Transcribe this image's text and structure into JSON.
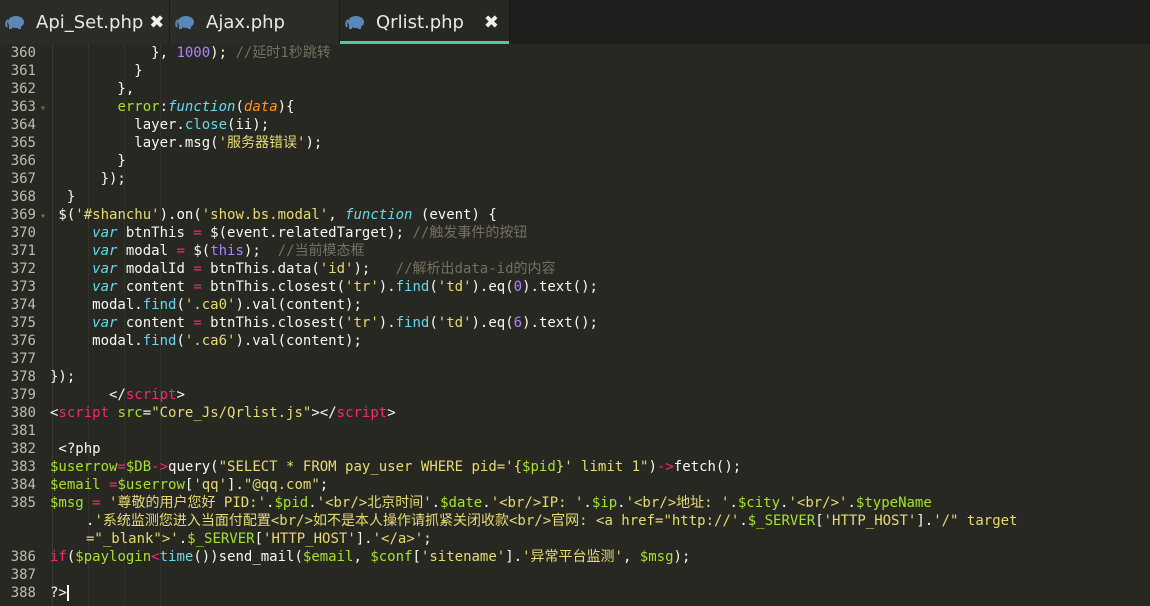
{
  "tabs": [
    {
      "label": "Api_Set.php",
      "close": "✖",
      "active": false
    },
    {
      "label": "Ajax.php",
      "close": "",
      "active": false
    },
    {
      "label": "Qrlist.php",
      "close": "✖",
      "active": true
    }
  ],
  "colors": {
    "background": "#272822",
    "tab_active_underline": "#50c8a0",
    "string": "#e6db74",
    "keyword": "#f92672",
    "function": "#66d9ef",
    "variable": "#a6e22e",
    "number": "#ae81ff",
    "comment": "#75715e"
  },
  "icons": {
    "tab": "php-elephant-icon",
    "fold": "fold-arrow-icon"
  },
  "lines": [
    {
      "n": "360",
      "fold": "",
      "segs": [
        [
          "p",
          "            }, "
        ],
        [
          "n",
          "1000"
        ],
        [
          "p",
          "); "
        ],
        [
          "c",
          "//延时1秒跳转"
        ]
      ]
    },
    {
      "n": "361",
      "fold": "",
      "segs": [
        [
          "p",
          "          }"
        ]
      ]
    },
    {
      "n": "362",
      "fold": "",
      "segs": [
        [
          "p",
          "        },"
        ]
      ]
    },
    {
      "n": "363",
      "fold": "▾",
      "segs": [
        [
          "p",
          "        "
        ],
        [
          "v",
          "error"
        ],
        [
          "p",
          ":"
        ],
        [
          "i",
          "function"
        ],
        [
          "p",
          "("
        ],
        [
          "a",
          "data"
        ],
        [
          "p",
          "){"
        ]
      ]
    },
    {
      "n": "364",
      "fold": "",
      "segs": [
        [
          "p",
          "          layer."
        ],
        [
          "f",
          "close"
        ],
        [
          "p",
          "(ii);"
        ]
      ]
    },
    {
      "n": "365",
      "fold": "",
      "segs": [
        [
          "p",
          "          layer.msg("
        ],
        [
          "s",
          "'服务器错误'"
        ],
        [
          "p",
          ");"
        ]
      ]
    },
    {
      "n": "366",
      "fold": "",
      "segs": [
        [
          "p",
          "        }"
        ]
      ]
    },
    {
      "n": "367",
      "fold": "",
      "segs": [
        [
          "p",
          "      });"
        ]
      ]
    },
    {
      "n": "368",
      "fold": "",
      "segs": [
        [
          "p",
          "  }"
        ]
      ]
    },
    {
      "n": "369",
      "fold": "▾",
      "segs": [
        [
          "p",
          " $("
        ],
        [
          "s",
          "'#shanchu'"
        ],
        [
          "p",
          ").on("
        ],
        [
          "s",
          "'show.bs.modal'"
        ],
        [
          "p",
          ", "
        ],
        [
          "i",
          "function"
        ],
        [
          "p",
          " (event) {"
        ]
      ]
    },
    {
      "n": "370",
      "fold": "",
      "segs": [
        [
          "p",
          "     "
        ],
        [
          "i",
          "var"
        ],
        [
          "p",
          " btnThis "
        ],
        [
          "k",
          "="
        ],
        [
          "p",
          " $(event.relatedTarget); "
        ],
        [
          "c",
          "//触发事件的按钮"
        ]
      ]
    },
    {
      "n": "371",
      "fold": "",
      "segs": [
        [
          "p",
          "     "
        ],
        [
          "i",
          "var"
        ],
        [
          "p",
          " modal "
        ],
        [
          "k",
          "="
        ],
        [
          "p",
          " $("
        ],
        [
          "n",
          "this"
        ],
        [
          "p",
          ");  "
        ],
        [
          "c",
          "//当前模态框"
        ]
      ]
    },
    {
      "n": "372",
      "fold": "",
      "segs": [
        [
          "p",
          "     "
        ],
        [
          "i",
          "var"
        ],
        [
          "p",
          " modalId "
        ],
        [
          "k",
          "="
        ],
        [
          "p",
          " btnThis.data("
        ],
        [
          "s",
          "'id'"
        ],
        [
          "p",
          ");   "
        ],
        [
          "c",
          "//解析出data-id的内容"
        ]
      ]
    },
    {
      "n": "373",
      "fold": "",
      "segs": [
        [
          "p",
          "     "
        ],
        [
          "i",
          "var"
        ],
        [
          "p",
          " content "
        ],
        [
          "k",
          "="
        ],
        [
          "p",
          " btnThis.closest("
        ],
        [
          "s",
          "'tr'"
        ],
        [
          "p",
          ")."
        ],
        [
          "f",
          "find"
        ],
        [
          "p",
          "("
        ],
        [
          "s",
          "'td'"
        ],
        [
          "p",
          ").eq("
        ],
        [
          "n",
          "0"
        ],
        [
          "p",
          ").text();"
        ]
      ]
    },
    {
      "n": "374",
      "fold": "",
      "segs": [
        [
          "p",
          "     modal."
        ],
        [
          "f",
          "find"
        ],
        [
          "p",
          "("
        ],
        [
          "s",
          "'.ca0'"
        ],
        [
          "p",
          ").val(content);"
        ]
      ]
    },
    {
      "n": "375",
      "fold": "",
      "segs": [
        [
          "p",
          "     "
        ],
        [
          "i",
          "var"
        ],
        [
          "p",
          " content "
        ],
        [
          "k",
          "="
        ],
        [
          "p",
          " btnThis.closest("
        ],
        [
          "s",
          "'tr'"
        ],
        [
          "p",
          ")."
        ],
        [
          "f",
          "find"
        ],
        [
          "p",
          "("
        ],
        [
          "s",
          "'td'"
        ],
        [
          "p",
          ").eq("
        ],
        [
          "n",
          "6"
        ],
        [
          "p",
          ").text();"
        ]
      ]
    },
    {
      "n": "376",
      "fold": "",
      "segs": [
        [
          "p",
          "     modal."
        ],
        [
          "f",
          "find"
        ],
        [
          "p",
          "("
        ],
        [
          "s",
          "'.ca6'"
        ],
        [
          "p",
          ").val(content);"
        ]
      ]
    },
    {
      "n": "377",
      "fold": "",
      "segs": [
        [
          "p",
          ""
        ]
      ]
    },
    {
      "n": "378",
      "fold": "",
      "segs": [
        [
          "p",
          "});"
        ]
      ]
    },
    {
      "n": "379",
      "fold": "",
      "segs": [
        [
          "p",
          "       </"
        ],
        [
          "k",
          "script"
        ],
        [
          "p",
          ">"
        ]
      ]
    },
    {
      "n": "380",
      "fold": "",
      "segs": [
        [
          "p",
          "<"
        ],
        [
          "k",
          "script"
        ],
        [
          "p",
          " "
        ],
        [
          "v",
          "src"
        ],
        [
          "p",
          "="
        ],
        [
          "s",
          "\"Core_Js/Qrlist.js\""
        ],
        [
          "p",
          "></"
        ],
        [
          "k",
          "script"
        ],
        [
          "p",
          ">"
        ]
      ]
    },
    {
      "n": "381",
      "fold": "",
      "segs": [
        [
          "p",
          ""
        ]
      ]
    },
    {
      "n": "382",
      "fold": "",
      "segs": [
        [
          "p",
          " <?php"
        ]
      ]
    },
    {
      "n": "383",
      "fold": "",
      "segs": [
        [
          "v",
          "$userrow"
        ],
        [
          "k",
          "="
        ],
        [
          "v",
          "$DB"
        ],
        [
          "k",
          "->"
        ],
        [
          "p",
          "query("
        ],
        [
          "s",
          "\"SELECT * FROM pay_user WHERE pid='{"
        ],
        [
          "v",
          "$pid"
        ],
        [
          "s",
          "}' limit 1\""
        ],
        [
          "p",
          ")"
        ],
        [
          "k",
          "->"
        ],
        [
          "p",
          "fetch();"
        ]
      ]
    },
    {
      "n": "384",
      "fold": "",
      "segs": [
        [
          "v",
          "$email"
        ],
        [
          "p",
          " "
        ],
        [
          "k",
          "="
        ],
        [
          "v",
          "$userrow"
        ],
        [
          "p",
          "["
        ],
        [
          "s",
          "'qq'"
        ],
        [
          "p",
          "]."
        ],
        [
          "s",
          "\"@qq.com\""
        ],
        [
          "p",
          ";"
        ]
      ]
    },
    {
      "n": "385",
      "fold": "",
      "segs": [
        [
          "v",
          "$msg"
        ],
        [
          "p",
          " "
        ],
        [
          "k",
          "="
        ],
        [
          "p",
          " "
        ],
        [
          "s",
          "'尊敬的用户您好 PID:'"
        ],
        [
          "p",
          "."
        ],
        [
          "v",
          "$pid"
        ],
        [
          "p",
          "."
        ],
        [
          "s",
          "'<br/>北京时间'"
        ],
        [
          "p",
          "."
        ],
        [
          "v",
          "$date"
        ],
        [
          "p",
          "."
        ],
        [
          "s",
          "'<br/>IP: '"
        ],
        [
          "p",
          "."
        ],
        [
          "v",
          "$ip"
        ],
        [
          "p",
          "."
        ],
        [
          "s",
          "'<br/>地址: '"
        ],
        [
          "p",
          "."
        ],
        [
          "v",
          "$city"
        ],
        [
          "p",
          "."
        ],
        [
          "s",
          "'<br/>'"
        ],
        [
          "p",
          "."
        ],
        [
          "v",
          "$typeName"
        ]
      ]
    },
    {
      "n": "",
      "fold": "",
      "wrap": true,
      "segs": [
        [
          "p",
          "."
        ],
        [
          "s",
          "'系统监测您进入当面付配置<br/>如不是本人操作请抓紧关闭收款<br/>官网: <a href=\"http://'"
        ],
        [
          "p",
          "."
        ],
        [
          "v",
          "$_SERVER"
        ],
        [
          "p",
          "["
        ],
        [
          "s",
          "'HTTP_HOST'"
        ],
        [
          "p",
          "]."
        ],
        [
          "s",
          "'/\" target"
        ]
      ]
    },
    {
      "n": "",
      "fold": "",
      "wrap": true,
      "segs": [
        [
          "s",
          "=\"_blank\">'"
        ],
        [
          "p",
          "."
        ],
        [
          "v",
          "$_SERVER"
        ],
        [
          "p",
          "["
        ],
        [
          "s",
          "'HTTP_HOST'"
        ],
        [
          "p",
          "]."
        ],
        [
          "s",
          "'</a>'"
        ],
        [
          "p",
          ";"
        ]
      ]
    },
    {
      "n": "386",
      "fold": "",
      "segs": [
        [
          "k",
          "if"
        ],
        [
          "p",
          "("
        ],
        [
          "v",
          "$paylogin"
        ],
        [
          "k",
          "<"
        ],
        [
          "f",
          "time"
        ],
        [
          "p",
          "())send_mail("
        ],
        [
          "v",
          "$email"
        ],
        [
          "p",
          ", "
        ],
        [
          "v",
          "$conf"
        ],
        [
          "p",
          "["
        ],
        [
          "s",
          "'sitename'"
        ],
        [
          "p",
          "]."
        ],
        [
          "s",
          "'异常平台监测'"
        ],
        [
          "p",
          ", "
        ],
        [
          "v",
          "$msg"
        ],
        [
          "p",
          ");"
        ]
      ]
    },
    {
      "n": "387",
      "fold": "",
      "segs": [
        [
          "p",
          ""
        ]
      ]
    },
    {
      "n": "388",
      "fold": "",
      "segs": [
        [
          "p",
          "?>"
        ]
      ],
      "cursor": true
    }
  ]
}
